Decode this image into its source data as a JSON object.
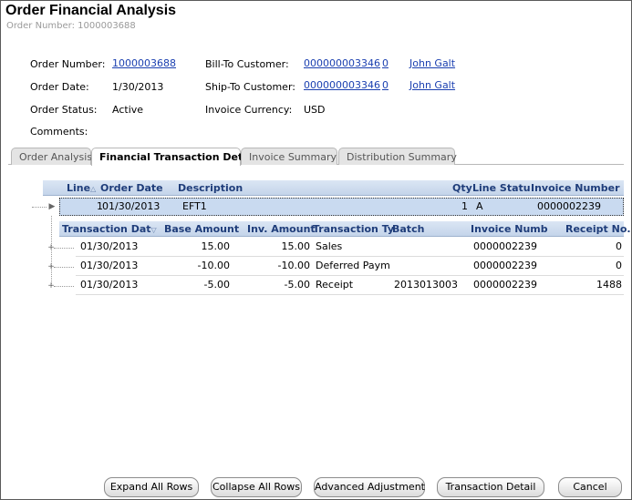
{
  "window": {
    "title": "Order Financial Analysis",
    "subtitle": "Order Number: 1000003688"
  },
  "order": {
    "number_label": "Order Number:",
    "number": "1000003688",
    "date_label": "Order Date:",
    "date": "1/30/2013",
    "status_label": "Order Status:",
    "status": "Active",
    "comments_label": "Comments:",
    "bill_to_label": "Bill-To Customer:",
    "bill_to_id": "000000003346",
    "bill_to_sub": "0",
    "bill_to_name": "John Galt",
    "ship_to_label": "Ship-To Customer:",
    "ship_to_id": "000000003346",
    "ship_to_sub": "0",
    "ship_to_name": "John Galt",
    "currency_label": "Invoice Currency:",
    "currency": "USD"
  },
  "tabs": [
    {
      "label": "Order Analysis"
    },
    {
      "label": "Financial Transaction Detail"
    },
    {
      "label": "Invoice Summary"
    },
    {
      "label": "Distribution Summary"
    }
  ],
  "parent_grid": {
    "headers": [
      "Line",
      "Order Date",
      "Description",
      "Qty",
      "Line Statu",
      "Invoice Number"
    ],
    "rows": [
      {
        "line": "1",
        "order_date": "01/30/2013",
        "description": "EFT1",
        "qty": "1",
        "status": "A",
        "invoice": "0000002239"
      }
    ]
  },
  "child_grid": {
    "headers": [
      "Transaction Dat",
      "Base Amount",
      "Inv. Amount",
      "Transaction Ty",
      "Batch",
      "Invoice Numb",
      "Receipt No."
    ],
    "rows": [
      {
        "date": "01/30/2013",
        "base": "15.00",
        "inv": "15.00",
        "type": "Sales",
        "batch": "",
        "invoice": "0000002239",
        "receipt": "0"
      },
      {
        "date": "01/30/2013",
        "base": "-10.00",
        "inv": "-10.00",
        "type": "Deferred Paym",
        "batch": "",
        "invoice": "0000002239",
        "receipt": "0"
      },
      {
        "date": "01/30/2013",
        "base": "-5.00",
        "inv": "-5.00",
        "type": "Receipt",
        "batch": "2013013003",
        "invoice": "0000002239",
        "receipt": "1488"
      }
    ]
  },
  "buttons": {
    "expand": "Expand All Rows",
    "collapse": "Collapse All Rows",
    "advanced": "Advanced Adjustment",
    "detail": "Transaction Detail",
    "cancel": "Cancel"
  },
  "icons": {
    "sort": "sort-ascending-icon",
    "expand": "expand-plus-icon",
    "row_pointer": "row-selector-icon"
  },
  "colors": {
    "link": "#1a3fb0",
    "header_text": "#1f3d7a",
    "header_bg": "#c4d4ea",
    "selected_row": "#c9daf0"
  }
}
